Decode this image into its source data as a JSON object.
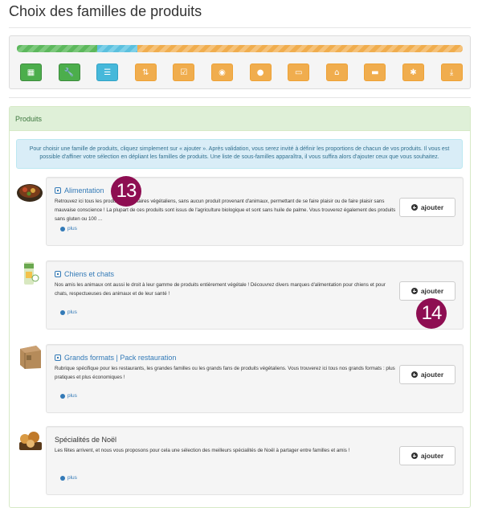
{
  "page_title": "Choix des familles de produits",
  "progress": {
    "segments": [
      {
        "color": "green",
        "fraction": 0.18
      },
      {
        "color": "blue",
        "fraction": 0.09
      },
      {
        "color": "orange",
        "fraction": 0.73
      }
    ]
  },
  "steps": [
    {
      "icon": "grid-icon",
      "glyph": "▦",
      "color": "green"
    },
    {
      "icon": "wrench-icon",
      "glyph": "🔧",
      "color": "green"
    },
    {
      "icon": "list-icon",
      "glyph": "☰",
      "color": "blue"
    },
    {
      "icon": "sort-icon",
      "glyph": "⇅",
      "color": "orange"
    },
    {
      "icon": "check-icon",
      "glyph": "☑",
      "color": "orange"
    },
    {
      "icon": "eye-icon",
      "glyph": "◉",
      "color": "orange"
    },
    {
      "icon": "user-icon",
      "glyph": "●",
      "color": "orange"
    },
    {
      "icon": "credit-card-icon",
      "glyph": "▭",
      "color": "orange"
    },
    {
      "icon": "home-icon",
      "glyph": "⌂",
      "color": "orange"
    },
    {
      "icon": "comment-icon",
      "glyph": "▬",
      "color": "orange"
    },
    {
      "icon": "asterisk-icon",
      "glyph": "✱",
      "color": "orange"
    },
    {
      "icon": "download-icon",
      "glyph": "⤓",
      "color": "orange"
    }
  ],
  "products_panel": {
    "heading": "Produits",
    "info": "Pour choisir une famille de produits, cliquez simplement sur « ajouter ». Après validation, vous serez invité à définir les proportions de chacun de vos produits. Il vous est possible d'affiner votre sélection en dépliant les familles de produits. Une liste de sous-familles apparaîtra, il vous suffira alors d'ajouter ceux que vous souhaitez."
  },
  "products": [
    {
      "title": "Alimentation",
      "expandable": true,
      "description": "Retrouvez ici tous les produits alimentaires végétaliens, sans aucun produit provenant d'animaux, permettant de se faire plaisir ou de faire plaisir sans mauvaise conscience ! La plupart de ces produits sont issus de l'agriculture biologique et sont sans huile de palme. Vous trouverez également des produits sans gluten ou 100 ...",
      "more_label": "plus",
      "add_label": "ajouter",
      "thumb": "food-bowl-thumbnail"
    },
    {
      "title": "Chiens et chats",
      "expandable": true,
      "description": "Nos amis les animaux ont aussi le droit à leur gamme de produits entièrement végétale ! Découvrez divers marques d'alimentation pour chiens et pour chats, respectueuses des animaux et de leur santé !",
      "more_label": "plus",
      "add_label": "ajouter",
      "thumb": "pet-food-bag-thumbnail"
    },
    {
      "title": "Grands formats | Pack restauration",
      "expandable": true,
      "description": "Rubrique spécifique pour les restaurants, les grandes familles ou les grands fans de produits végétaliens. Vous trouverez ici tous nos grands formats : plus pratiques et plus économiques !",
      "more_label": "plus",
      "add_label": "ajouter",
      "thumb": "cardboard-box-thumbnail"
    },
    {
      "title": "Spécialités de Noël",
      "expandable": false,
      "description": "Les fêtes arrivent, et nous vous proposons pour cela une sélection des meilleurs spécialités de Noël à partager entre familles et amis !",
      "more_label": "plus",
      "add_label": "ajouter",
      "thumb": "christmas-cookies-thumbnail"
    }
  ],
  "annotations": [
    {
      "label": "13"
    },
    {
      "label": "14"
    }
  ]
}
